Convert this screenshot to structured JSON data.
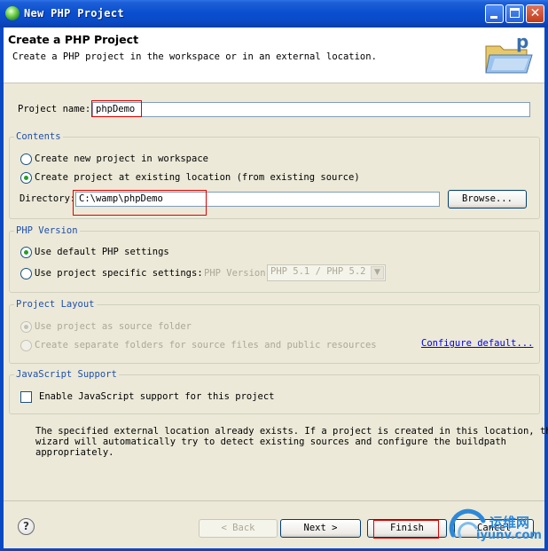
{
  "window": {
    "title": "New PHP Project",
    "buttons": [
      "minimize-icon",
      "maximize-icon",
      "close-icon"
    ]
  },
  "header": {
    "title": "Create a PHP Project",
    "description": "Create a PHP project in the workspace or in an external location.",
    "icon": "php-folder-icon"
  },
  "project_name": {
    "label": "Project name:",
    "value": "phpDemo"
  },
  "contents": {
    "group_label": "Contents",
    "options": [
      {
        "label": "Create new project in workspace",
        "selected": false
      },
      {
        "label": "Create project at existing location (from existing source)",
        "selected": true
      }
    ],
    "directory_label": "Directory:",
    "directory_value": "C:\\wamp\\phpDemo",
    "browse_label": "Browse..."
  },
  "php_version": {
    "group_label": "PHP Version",
    "options": [
      {
        "label": "Use default PHP settings",
        "selected": true
      },
      {
        "label": "Use project specific settings:",
        "selected": false
      }
    ],
    "version_label": "PHP Version:",
    "version_value": "PHP 5.1 / PHP 5.2"
  },
  "project_layout": {
    "group_label": "Project Layout",
    "options": [
      {
        "label": "Use project as source folder",
        "selected": true
      },
      {
        "label": "Create separate folders for source files and public resources",
        "selected": false
      }
    ],
    "configure_link": "Configure default..."
  },
  "javascript": {
    "group_label": "JavaScript Support",
    "checkbox_label": "Enable JavaScript support for this project",
    "checked": false
  },
  "message": "The specified external location already exists. If a project is created in this location, the\nwizard will automatically try to detect existing sources and configure the buildpath\nappropriately.",
  "footer": {
    "help": "?",
    "back": "< Back",
    "next": "Next >",
    "finish": "Finish",
    "cancel": "Cancel"
  },
  "watermark": {
    "top": "运维网",
    "bottom": "iyunv.com"
  },
  "colors": {
    "titlebar": "#0a49c4",
    "dialog_bg": "#ece9d8",
    "group_label": "#1f4fa8",
    "highlight_box": "#e00000",
    "link": "#0000ee"
  }
}
